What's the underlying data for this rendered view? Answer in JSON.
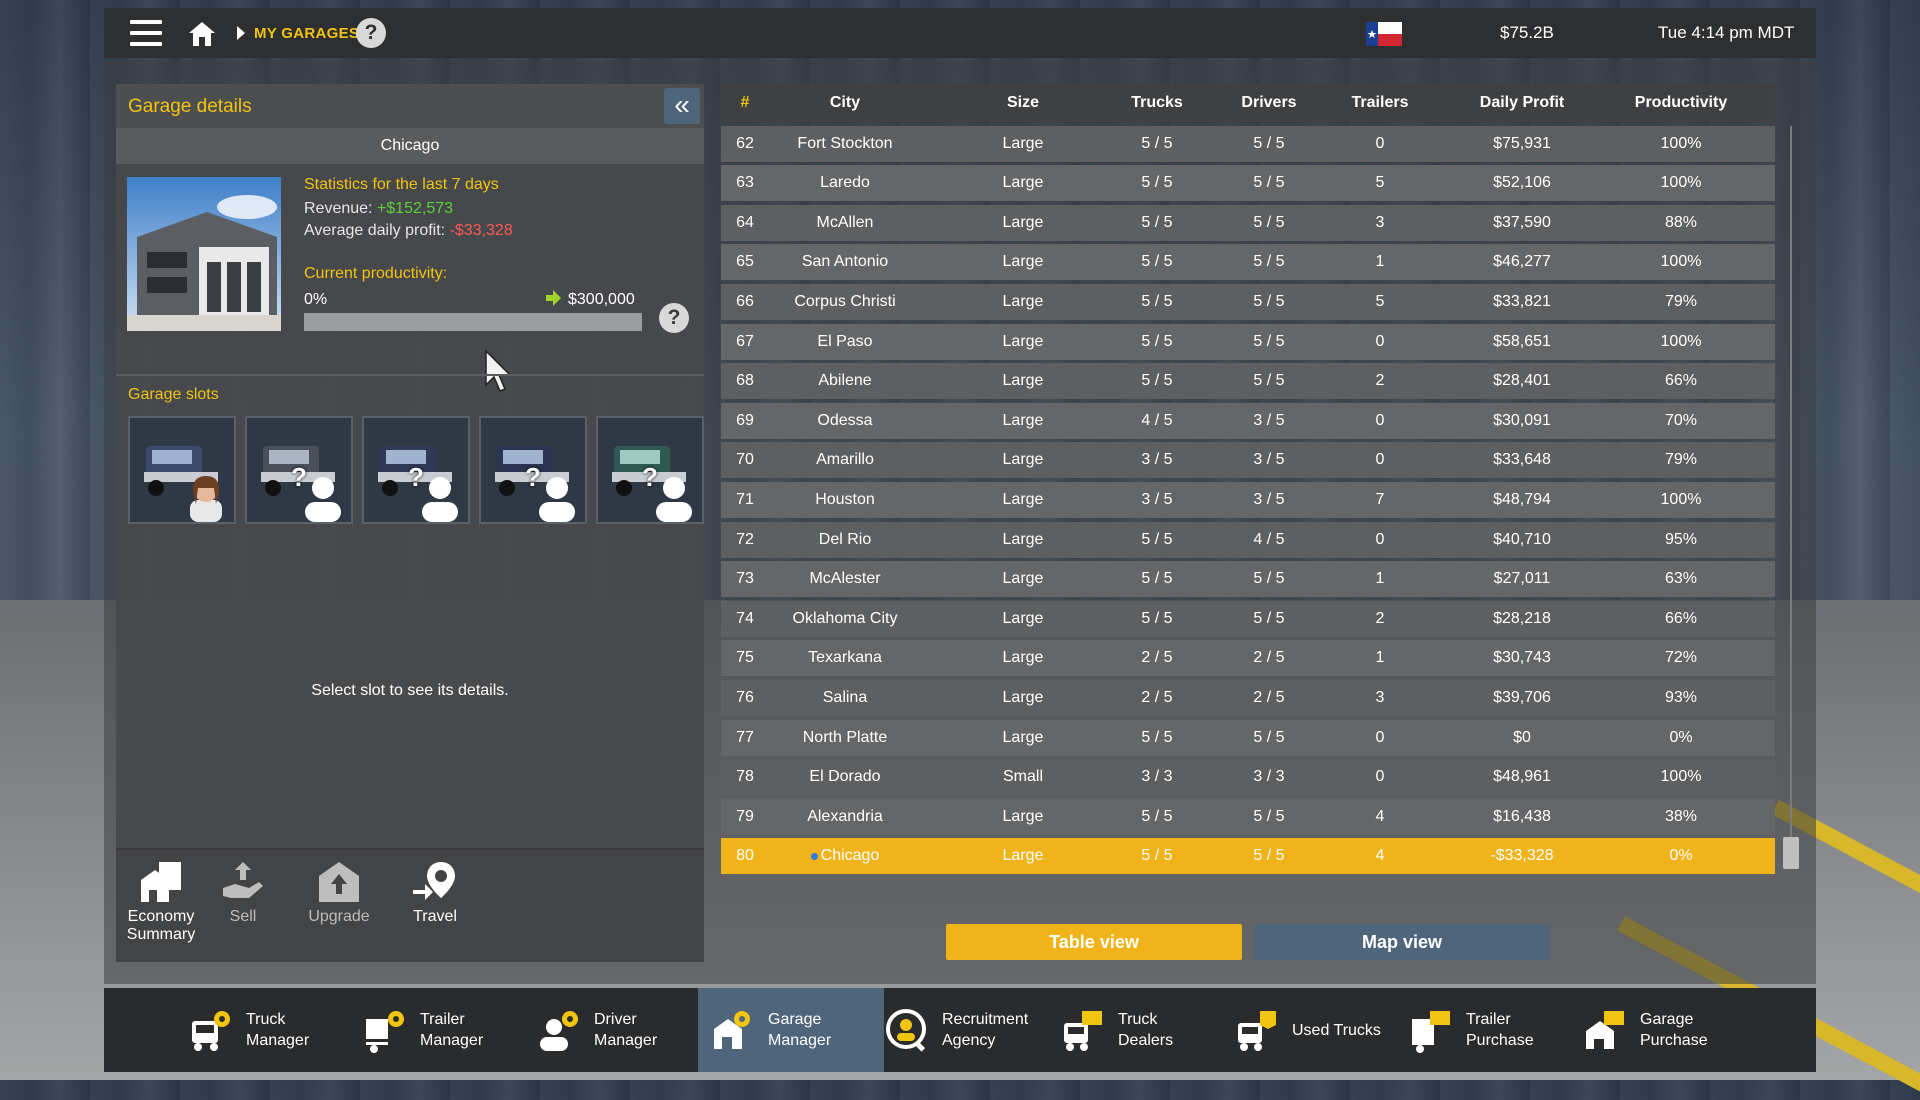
{
  "topbar": {
    "breadcrumb": "MY GARAGES",
    "help": "?",
    "money": "$75.2B",
    "clock": "Tue 4:14 pm MDT"
  },
  "garage_details": {
    "title": "Garage details",
    "city": "Chicago",
    "stats_title": "Statistics for the last 7 days",
    "revenue_label": "Revenue: ",
    "revenue_value": "+$152,573",
    "avg_label": "Average daily profit: ",
    "avg_value": "-$33,328",
    "productivity_title": "Current productivity:",
    "productivity_min": "0%",
    "productivity_max": "$300,000",
    "productivity_level": 0,
    "help": "?",
    "slots_title": "Garage slots",
    "slot_message": "Select slot to see its details."
  },
  "actions": {
    "economy": [
      "Economy",
      "Summary"
    ],
    "sell": "Sell",
    "upgrade": "Upgrade",
    "travel": "Travel"
  },
  "table": {
    "headers": [
      "#",
      "City",
      "Size",
      "Trucks",
      "Drivers",
      "Trailers",
      "Daily Profit",
      "Productivity"
    ],
    "rows": [
      [
        "62",
        "Fort Stockton",
        "Large",
        "5 / 5",
        "5 / 5",
        "0",
        "$75,931",
        "100%"
      ],
      [
        "63",
        "Laredo",
        "Large",
        "5 / 5",
        "5 / 5",
        "5",
        "$52,106",
        "100%"
      ],
      [
        "64",
        "McAllen",
        "Large",
        "5 / 5",
        "5 / 5",
        "3",
        "$37,590",
        "88%"
      ],
      [
        "65",
        "San Antonio",
        "Large",
        "5 / 5",
        "5 / 5",
        "1",
        "$46,277",
        "100%"
      ],
      [
        "66",
        "Corpus Christi",
        "Large",
        "5 / 5",
        "5 / 5",
        "5",
        "$33,821",
        "79%"
      ],
      [
        "67",
        "El Paso",
        "Large",
        "5 / 5",
        "5 / 5",
        "0",
        "$58,651",
        "100%"
      ],
      [
        "68",
        "Abilene",
        "Large",
        "5 / 5",
        "5 / 5",
        "2",
        "$28,401",
        "66%"
      ],
      [
        "69",
        "Odessa",
        "Large",
        "4 / 5",
        "3 / 5",
        "0",
        "$30,091",
        "70%"
      ],
      [
        "70",
        "Amarillo",
        "Large",
        "3 / 5",
        "3 / 5",
        "0",
        "$33,648",
        "79%"
      ],
      [
        "71",
        "Houston",
        "Large",
        "3 / 5",
        "3 / 5",
        "7",
        "$48,794",
        "100%"
      ],
      [
        "72",
        "Del Rio",
        "Large",
        "5 / 5",
        "4 / 5",
        "0",
        "$40,710",
        "95%"
      ],
      [
        "73",
        "McAlester",
        "Large",
        "5 / 5",
        "5 / 5",
        "1",
        "$27,011",
        "63%"
      ],
      [
        "74",
        "Oklahoma City",
        "Large",
        "5 / 5",
        "5 / 5",
        "2",
        "$28,218",
        "66%"
      ],
      [
        "75",
        "Texarkana",
        "Large",
        "2 / 5",
        "2 / 5",
        "1",
        "$30,743",
        "72%"
      ],
      [
        "76",
        "Salina",
        "Large",
        "2 / 5",
        "2 / 5",
        "3",
        "$39,706",
        "93%"
      ],
      [
        "77",
        "North Platte",
        "Large",
        "5 / 5",
        "5 / 5",
        "0",
        "$0",
        "0%"
      ],
      [
        "78",
        "El Dorado",
        "Small",
        "3 / 3",
        "3 / 3",
        "0",
        "$48,961",
        "100%"
      ],
      [
        "79",
        "Alexandria",
        "Large",
        "5 / 5",
        "5 / 5",
        "4",
        "$16,438",
        "38%"
      ],
      [
        "80",
        "Chicago",
        "Large",
        "5 / 5",
        "5 / 5",
        "4",
        "-$33,328",
        "0%"
      ]
    ],
    "selected_row": "80"
  },
  "views": {
    "table": "Table view",
    "map": "Map view"
  },
  "nav": [
    [
      "Truck",
      "Manager"
    ],
    [
      "Trailer",
      "Manager"
    ],
    [
      "Driver",
      "Manager"
    ],
    [
      "Garage",
      "Manager"
    ],
    [
      "Recruitment",
      "Agency"
    ],
    [
      "Truck",
      "Dealers"
    ],
    [
      "Used Trucks",
      ""
    ],
    [
      "Trailer",
      "Purchase"
    ],
    [
      "Garage",
      "Purchase"
    ]
  ],
  "colors": {
    "accent": "#f1b31a",
    "active_nav": "#4f657b",
    "positive": "#59d13b",
    "negative": "#ff5a55"
  }
}
